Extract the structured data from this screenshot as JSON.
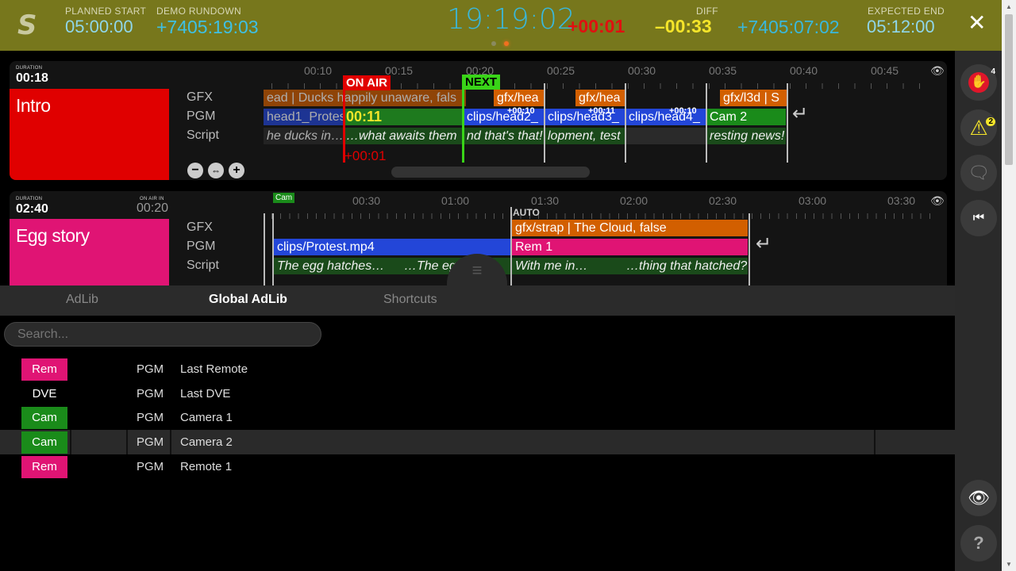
{
  "header": {
    "logo": "S",
    "planned_start_label": "PLANNED START",
    "planned_start": "05:00:00",
    "rundown_label": "DEMO RUNDOWN",
    "rundown_value": "+7405:19:03",
    "clock": "19:19:02",
    "over": "+00:01",
    "segment_diff": "–00:33",
    "diff_label": "DIFF",
    "diff_value": "+7405:07:02",
    "expected_end_label": "EXPECTED END",
    "expected_end": "05:12:00",
    "close": "✕"
  },
  "parts": [
    {
      "duration_label": "DURATION",
      "duration": "00:18",
      "title": "Intro",
      "color": "#e00000",
      "layers": [
        "GFX",
        "PGM",
        "Script"
      ],
      "ticks": [
        "00:10",
        "00:15",
        "00:20",
        "00:25",
        "00:30",
        "00:35",
        "00:40",
        "00:45"
      ],
      "on_air": "ON AIR",
      "next": "NEXT",
      "elapsed": "00:11",
      "over_time": "+00:01",
      "gfx": [
        "ead | Ducks happily unaware, fals",
        "gfx/hea",
        "gfx/hea",
        "gfx/l3d | S"
      ],
      "pgm": [
        "head1_Protes",
        "clips/head2_",
        "clips/head3_",
        "clips/head4_",
        "Cam 2"
      ],
      "pgm_badges": [
        "+00:10",
        "+00:11",
        "+00:10"
      ],
      "script": [
        "he ducks in…",
        "…what awaits them",
        "nd that's that!",
        "lopment, test",
        "resting news!"
      ],
      "controls": [
        "−",
        "⇔",
        "+"
      ]
    },
    {
      "duration_label": "DURATION",
      "duration": "02:40",
      "on_air_in_label": "ON AIR IN",
      "on_air_in": "00:20",
      "title": "Egg story",
      "color": "#e01474",
      "layers": [
        "GFX",
        "PGM",
        "Script"
      ],
      "ticks": [
        "00:30",
        "01:00",
        "01:30",
        "02:00",
        "02:30",
        "03:00",
        "03:30"
      ],
      "cam_tag": "Cam",
      "auto": "AUTO",
      "gfx": [
        "gfx/strap | The Cloud, false"
      ],
      "pgm": [
        "clips/Protest.mp4",
        "Rem 1"
      ],
      "script": [
        "The egg hatches…",
        "…The egg",
        "With me in…",
        "…thing that hatched?"
      ]
    }
  ],
  "tabs": [
    "AdLib",
    "Global AdLib",
    "Shortcuts"
  ],
  "search": {
    "placeholder": "Search..."
  },
  "adlibs": [
    {
      "source": "Rem",
      "layer": "PGM",
      "name": "Last Remote",
      "color": "#e01474"
    },
    {
      "source": "DVE",
      "layer": "PGM",
      "name": "Last DVE",
      "color": ""
    },
    {
      "source": "Cam",
      "layer": "PGM",
      "name": "Camera 1",
      "color": "#1a8b1a"
    },
    {
      "source": "Cam",
      "layer": "PGM",
      "name": "Camera 2",
      "color": "#1a8b1a"
    },
    {
      "source": "Rem",
      "layer": "PGM",
      "name": "Remote 1",
      "color": "#e01474"
    }
  ],
  "rightbar": {
    "badge_stop": "4",
    "badge_warn": "2"
  }
}
